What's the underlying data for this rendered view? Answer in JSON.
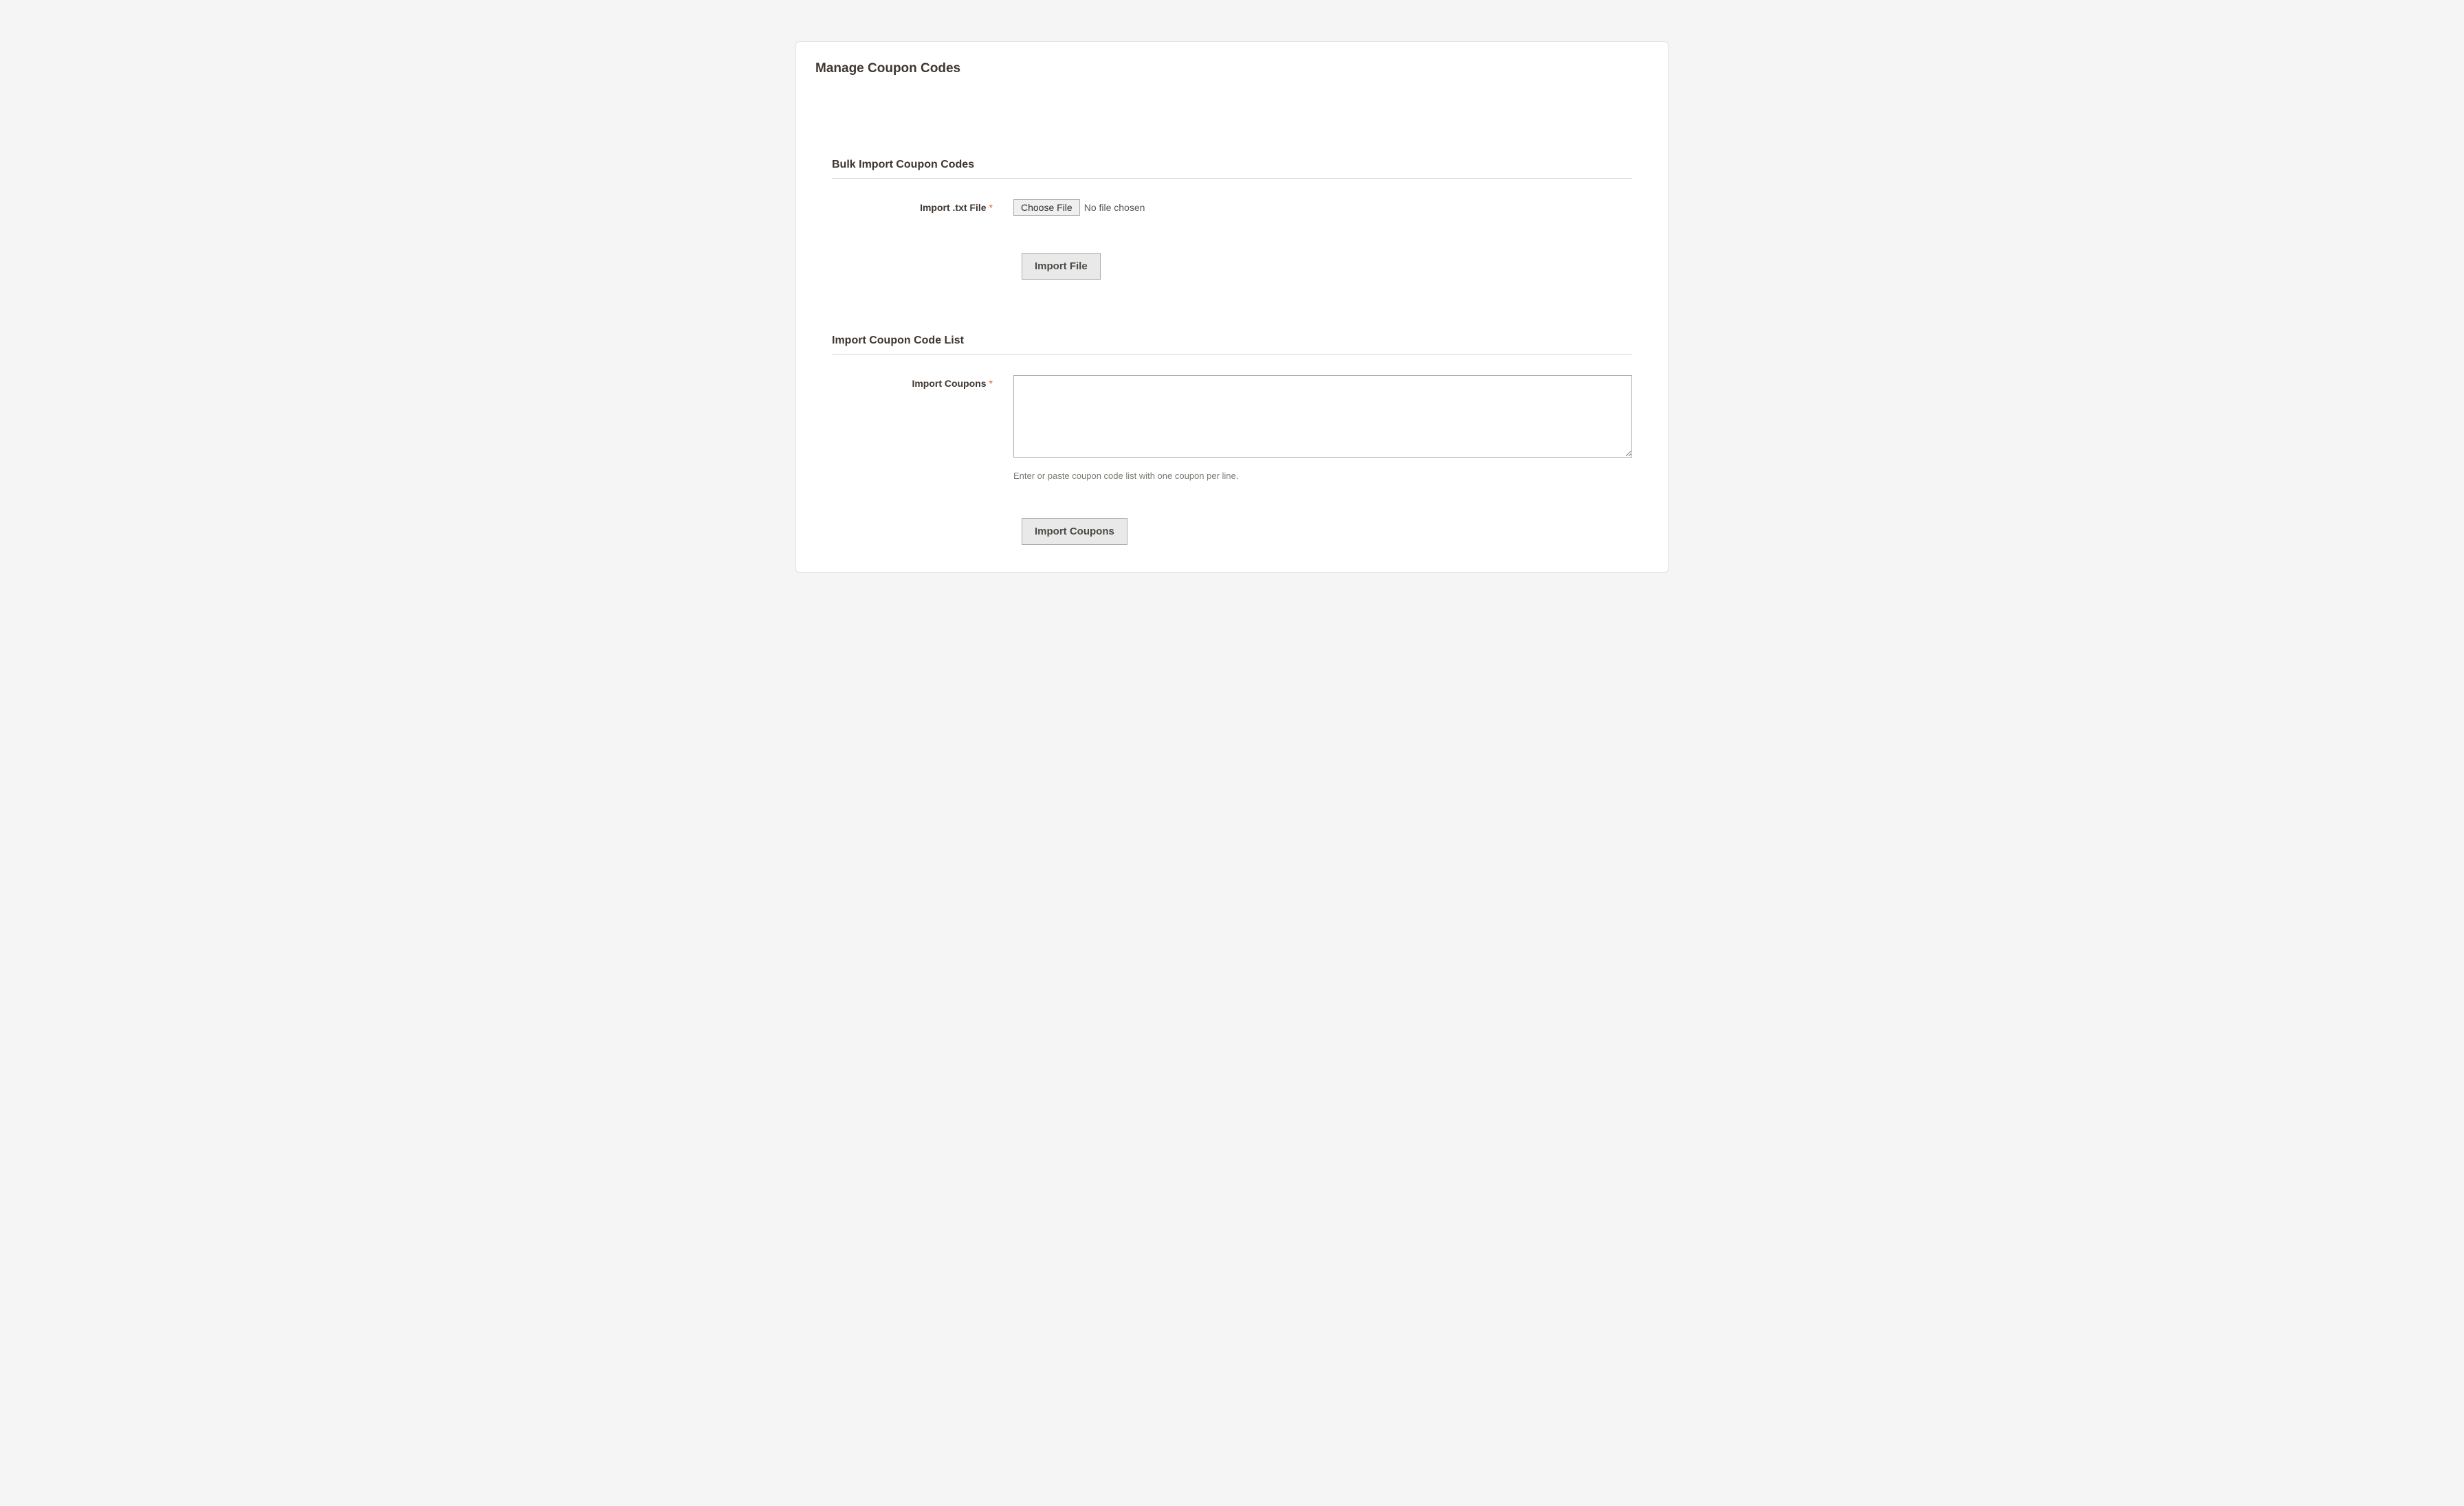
{
  "page": {
    "title": "Manage Coupon Codes"
  },
  "section1": {
    "heading": "Bulk Import Coupon Codes",
    "file_field": {
      "label": "Import .txt File",
      "required_mark": "*",
      "choose_button": "Choose File",
      "status": "No file chosen"
    },
    "import_button": "Import File"
  },
  "section2": {
    "heading": "Import Coupon Code List",
    "coupons_field": {
      "label": "Import Coupons",
      "required_mark": "*",
      "value": "",
      "help_text": "Enter or paste coupon code list with one coupon per line."
    },
    "import_button": "Import Coupons"
  }
}
